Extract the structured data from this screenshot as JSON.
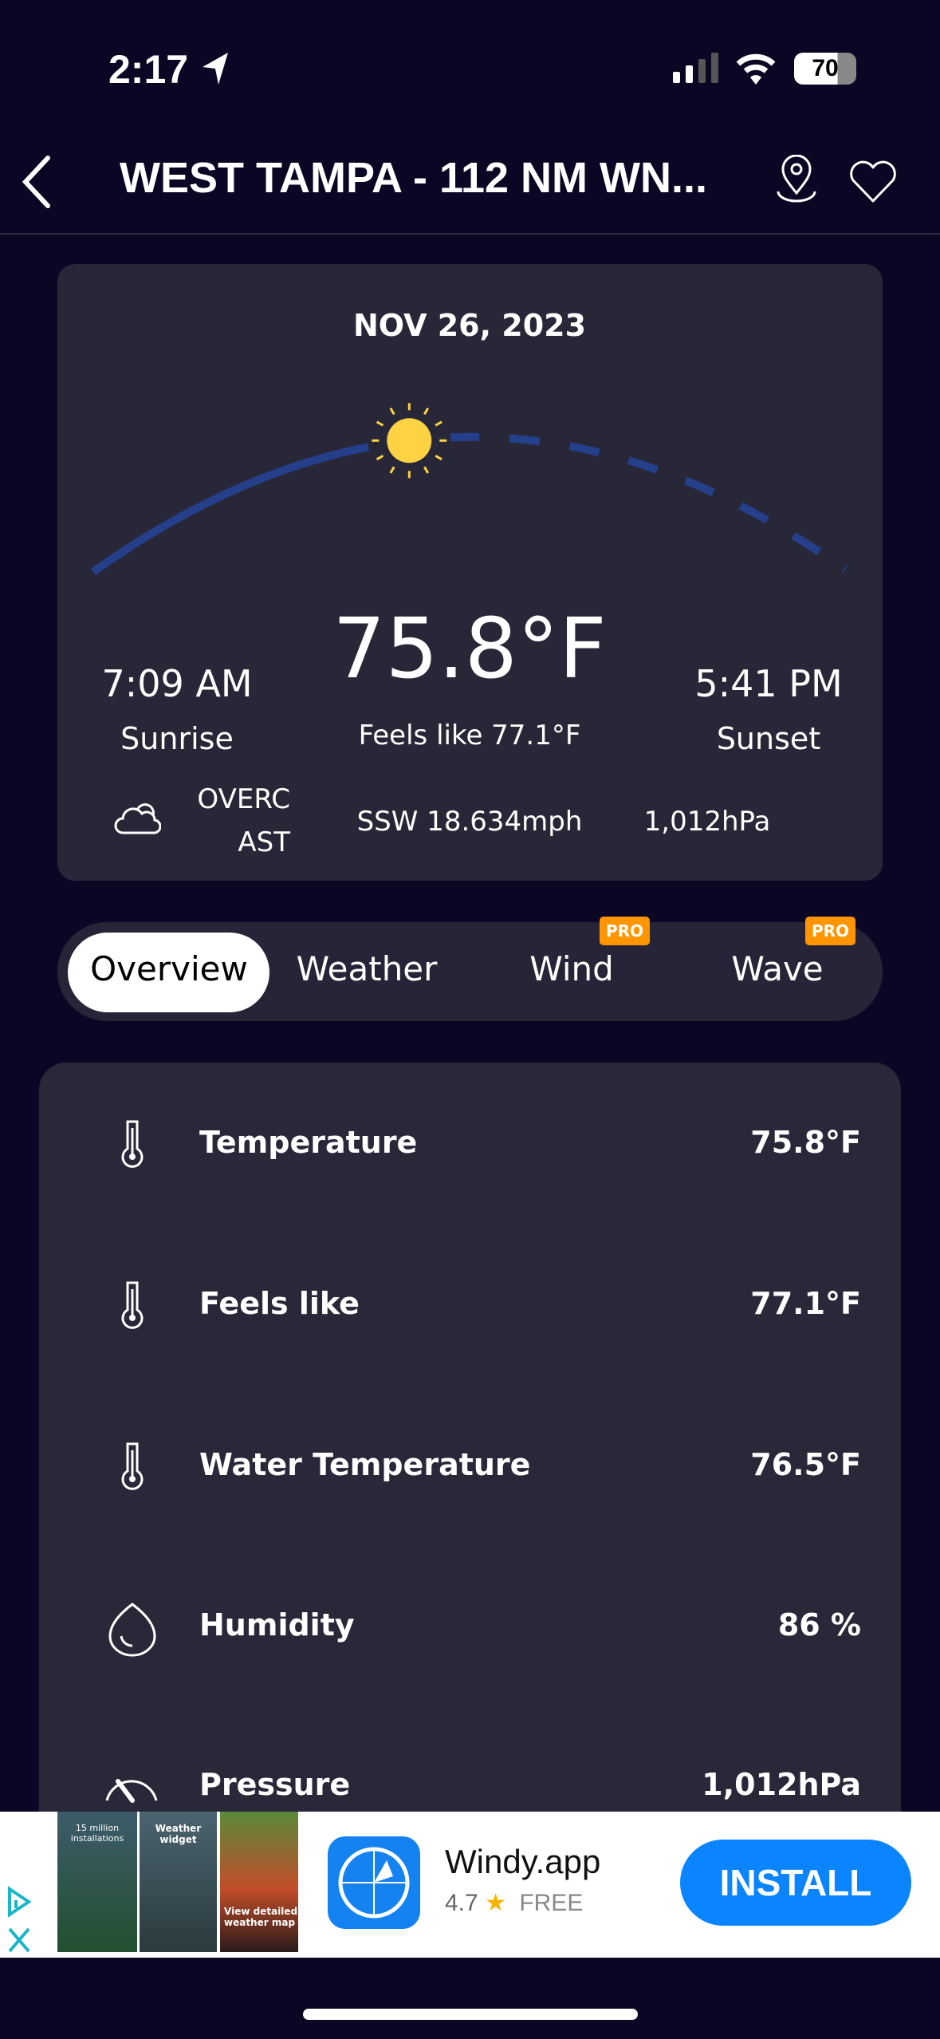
{
  "status_bar": {
    "time": "2:17",
    "battery": "70"
  },
  "header": {
    "title": "WEST TAMPA  - 112 NM WN..."
  },
  "summary": {
    "date": "NOV 26, 2023",
    "temperature": "75.8°F",
    "feels_like": "Feels like 77.1°F",
    "sunrise_time": "7:09 AM",
    "sunrise_label": "Sunrise",
    "sunset_time": "5:41 PM",
    "sunset_label": "Sunset",
    "condition_line1": "OVERC",
    "condition_line2": "AST",
    "wind": "SSW 18.634mph",
    "pressure": "1,012hPa",
    "sun_progress": 0.42,
    "colors": {
      "arc": "#263f8a",
      "sun": "#fdd243"
    }
  },
  "tabs": [
    {
      "label": "Overview",
      "active": true
    },
    {
      "label": "Weather"
    },
    {
      "label": "Wind",
      "badge": "PRO"
    },
    {
      "label": "Wave",
      "badge": "PRO"
    }
  ],
  "rows": [
    {
      "icon": "thermometer-icon",
      "label": "Temperature",
      "value": "75.8°F"
    },
    {
      "icon": "thermometer-icon",
      "label": "Feels like",
      "value": "77.1°F"
    },
    {
      "icon": "thermometer-icon",
      "label": "Water Temperature",
      "value": "76.5°F"
    },
    {
      "icon": "droplet-icon",
      "label": "Humidity",
      "value": "86 %"
    },
    {
      "icon": "gauge-icon",
      "label": "Pressure",
      "value": "1,012hPa"
    }
  ],
  "ad": {
    "app_name": "Windy.app",
    "rating": "4.7",
    "price": "FREE",
    "install": "INSTALL",
    "shot1": "15 million installations",
    "shot2": "Weather widget",
    "shot3": "View detailed weather map"
  }
}
